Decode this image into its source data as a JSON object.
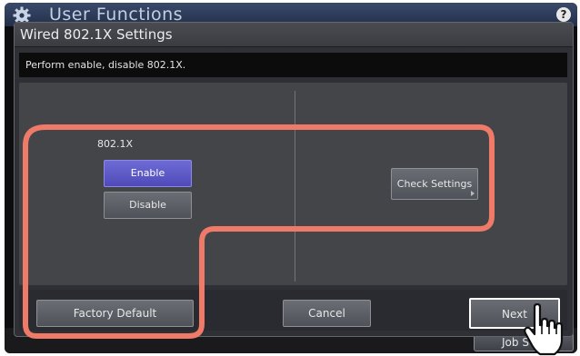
{
  "app": {
    "title": "User Functions",
    "help_label": "?",
    "job_status_label": "Job S"
  },
  "dialog": {
    "title": "Wired 802.1X Settings",
    "info_text": "Perform enable, disable 802.1X.",
    "setting_label": "802.1X",
    "enable_label": "Enable",
    "disable_label": "Disable",
    "selected": "Enable",
    "check_settings_label": "Check Settings",
    "factory_default_label": "Factory Default",
    "cancel_label": "Cancel",
    "next_label": "Next"
  },
  "colors": {
    "selected_button": "#5c59c8",
    "highlight_outline": "#ef7a67",
    "dialog_background": "#2f3035"
  },
  "icons": {
    "app": "gear-icon",
    "help": "help-icon",
    "pointer": "pointing-hand-icon"
  }
}
